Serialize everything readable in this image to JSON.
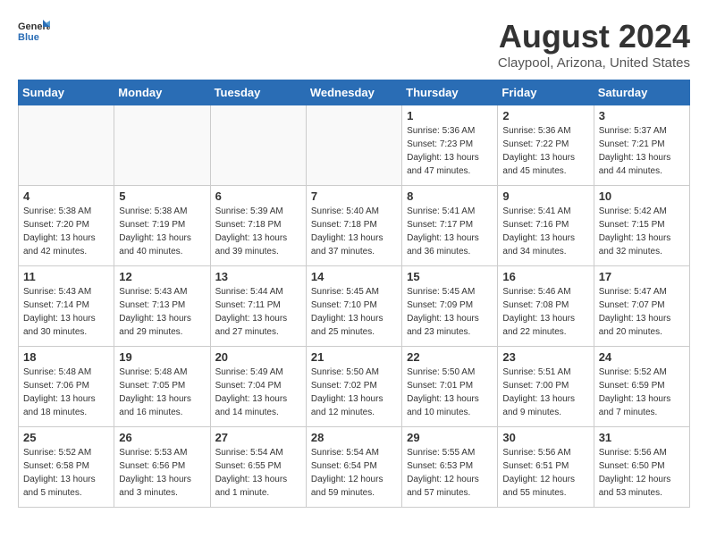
{
  "logo": {
    "general": "General",
    "blue": "Blue"
  },
  "title": {
    "month_year": "August 2024",
    "location": "Claypool, Arizona, United States"
  },
  "headers": [
    "Sunday",
    "Monday",
    "Tuesday",
    "Wednesday",
    "Thursday",
    "Friday",
    "Saturday"
  ],
  "weeks": [
    [
      {
        "day": "",
        "info": ""
      },
      {
        "day": "",
        "info": ""
      },
      {
        "day": "",
        "info": ""
      },
      {
        "day": "",
        "info": ""
      },
      {
        "day": "1",
        "info": "Sunrise: 5:36 AM\nSunset: 7:23 PM\nDaylight: 13 hours\nand 47 minutes."
      },
      {
        "day": "2",
        "info": "Sunrise: 5:36 AM\nSunset: 7:22 PM\nDaylight: 13 hours\nand 45 minutes."
      },
      {
        "day": "3",
        "info": "Sunrise: 5:37 AM\nSunset: 7:21 PM\nDaylight: 13 hours\nand 44 minutes."
      }
    ],
    [
      {
        "day": "4",
        "info": "Sunrise: 5:38 AM\nSunset: 7:20 PM\nDaylight: 13 hours\nand 42 minutes."
      },
      {
        "day": "5",
        "info": "Sunrise: 5:38 AM\nSunset: 7:19 PM\nDaylight: 13 hours\nand 40 minutes."
      },
      {
        "day": "6",
        "info": "Sunrise: 5:39 AM\nSunset: 7:18 PM\nDaylight: 13 hours\nand 39 minutes."
      },
      {
        "day": "7",
        "info": "Sunrise: 5:40 AM\nSunset: 7:18 PM\nDaylight: 13 hours\nand 37 minutes."
      },
      {
        "day": "8",
        "info": "Sunrise: 5:41 AM\nSunset: 7:17 PM\nDaylight: 13 hours\nand 36 minutes."
      },
      {
        "day": "9",
        "info": "Sunrise: 5:41 AM\nSunset: 7:16 PM\nDaylight: 13 hours\nand 34 minutes."
      },
      {
        "day": "10",
        "info": "Sunrise: 5:42 AM\nSunset: 7:15 PM\nDaylight: 13 hours\nand 32 minutes."
      }
    ],
    [
      {
        "day": "11",
        "info": "Sunrise: 5:43 AM\nSunset: 7:14 PM\nDaylight: 13 hours\nand 30 minutes."
      },
      {
        "day": "12",
        "info": "Sunrise: 5:43 AM\nSunset: 7:13 PM\nDaylight: 13 hours\nand 29 minutes."
      },
      {
        "day": "13",
        "info": "Sunrise: 5:44 AM\nSunset: 7:11 PM\nDaylight: 13 hours\nand 27 minutes."
      },
      {
        "day": "14",
        "info": "Sunrise: 5:45 AM\nSunset: 7:10 PM\nDaylight: 13 hours\nand 25 minutes."
      },
      {
        "day": "15",
        "info": "Sunrise: 5:45 AM\nSunset: 7:09 PM\nDaylight: 13 hours\nand 23 minutes."
      },
      {
        "day": "16",
        "info": "Sunrise: 5:46 AM\nSunset: 7:08 PM\nDaylight: 13 hours\nand 22 minutes."
      },
      {
        "day": "17",
        "info": "Sunrise: 5:47 AM\nSunset: 7:07 PM\nDaylight: 13 hours\nand 20 minutes."
      }
    ],
    [
      {
        "day": "18",
        "info": "Sunrise: 5:48 AM\nSunset: 7:06 PM\nDaylight: 13 hours\nand 18 minutes."
      },
      {
        "day": "19",
        "info": "Sunrise: 5:48 AM\nSunset: 7:05 PM\nDaylight: 13 hours\nand 16 minutes."
      },
      {
        "day": "20",
        "info": "Sunrise: 5:49 AM\nSunset: 7:04 PM\nDaylight: 13 hours\nand 14 minutes."
      },
      {
        "day": "21",
        "info": "Sunrise: 5:50 AM\nSunset: 7:02 PM\nDaylight: 13 hours\nand 12 minutes."
      },
      {
        "day": "22",
        "info": "Sunrise: 5:50 AM\nSunset: 7:01 PM\nDaylight: 13 hours\nand 10 minutes."
      },
      {
        "day": "23",
        "info": "Sunrise: 5:51 AM\nSunset: 7:00 PM\nDaylight: 13 hours\nand 9 minutes."
      },
      {
        "day": "24",
        "info": "Sunrise: 5:52 AM\nSunset: 6:59 PM\nDaylight: 13 hours\nand 7 minutes."
      }
    ],
    [
      {
        "day": "25",
        "info": "Sunrise: 5:52 AM\nSunset: 6:58 PM\nDaylight: 13 hours\nand 5 minutes."
      },
      {
        "day": "26",
        "info": "Sunrise: 5:53 AM\nSunset: 6:56 PM\nDaylight: 13 hours\nand 3 minutes."
      },
      {
        "day": "27",
        "info": "Sunrise: 5:54 AM\nSunset: 6:55 PM\nDaylight: 13 hours\nand 1 minute."
      },
      {
        "day": "28",
        "info": "Sunrise: 5:54 AM\nSunset: 6:54 PM\nDaylight: 12 hours\nand 59 minutes."
      },
      {
        "day": "29",
        "info": "Sunrise: 5:55 AM\nSunset: 6:53 PM\nDaylight: 12 hours\nand 57 minutes."
      },
      {
        "day": "30",
        "info": "Sunrise: 5:56 AM\nSunset: 6:51 PM\nDaylight: 12 hours\nand 55 minutes."
      },
      {
        "day": "31",
        "info": "Sunrise: 5:56 AM\nSunset: 6:50 PM\nDaylight: 12 hours\nand 53 minutes."
      }
    ]
  ]
}
